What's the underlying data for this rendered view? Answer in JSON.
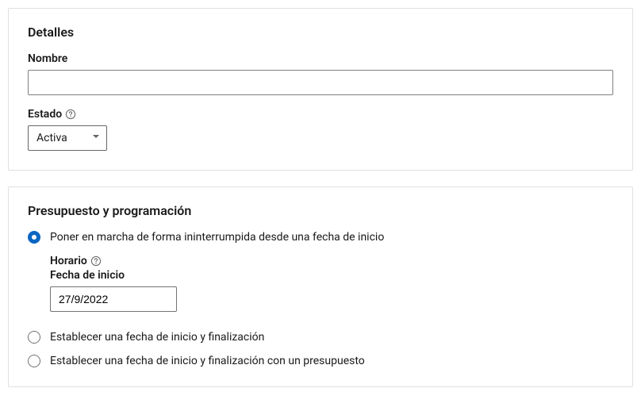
{
  "details": {
    "title": "Detalles",
    "name_label": "Nombre",
    "name_value": "",
    "status_label": "Estado",
    "status_value": "Activa"
  },
  "budget": {
    "title": "Presupuesto y programación",
    "options": {
      "continuous": "Poner en marcha de forma ininterrumpida desde una fecha de inicio",
      "start_end": "Establecer una fecha de inicio y finalización",
      "start_end_budget": "Establecer una fecha de inicio y finalización con un presupuesto"
    },
    "schedule_label": "Horario",
    "start_date_label": "Fecha de inicio",
    "start_date_value": "27/9/2022"
  }
}
